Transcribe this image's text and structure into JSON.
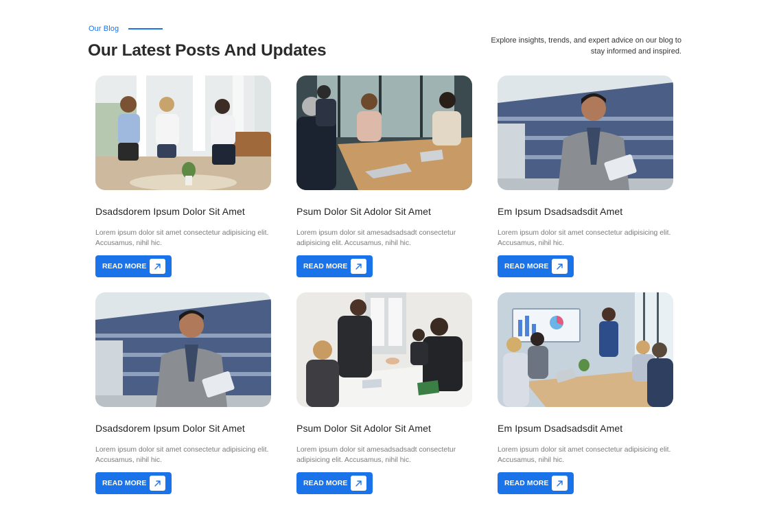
{
  "header": {
    "tag": "Our Blog",
    "title": "Our Latest Posts And Updates",
    "intro": "Explore insights, trends, and expert advice on our blog to stay informed and inspired."
  },
  "colors": {
    "accent": "#1a73e8",
    "title": "#2b2b2b",
    "excerpt": "#7a7a7a"
  },
  "posts": [
    {
      "title": "Dsadsdorem Ipsum Dolor Sit Amet",
      "excerpt": "Lorem ipsum dolor sit amet consectetur adipisicing elit. Accusamus, nihil hic.",
      "button": "READ MORE",
      "button_icon": "arrow-up-right-icon",
      "image": "office-lounge-meeting"
    },
    {
      "title": "Psum Dolor Sit Adolor Sit Amet",
      "excerpt": "Lorem ipsum dolor sit amesadsadsadt consectetur adipisicing elit. Accusamus, nihil hic.",
      "button": "READ MORE",
      "button_icon": "arrow-up-right-icon",
      "image": "conference-table-team"
    },
    {
      "title": "Em Ipsum Dsadsadsdit Amet",
      "excerpt": "Lorem ipsum dolor sit amet consectetur adipisicing elit. Accusamus, nihil hic.",
      "button": "READ MORE",
      "button_icon": "arrow-up-right-icon",
      "image": "businessman-with-tablet"
    },
    {
      "title": "Dsadsdorem Ipsum Dolor Sit Amet",
      "excerpt": "Lorem ipsum dolor sit amet consectetur adipisicing elit. Accusamus, nihil hic.",
      "button": "READ MORE",
      "button_icon": "arrow-up-right-icon",
      "image": "businessman-with-tablet"
    },
    {
      "title": "Psum Dolor Sit Adolor Sit Amet",
      "excerpt": "Lorem ipsum dolor sit amesadsadsadt consectetur adipisicing elit. Accusamus, nihil hic.",
      "button": "READ MORE",
      "button_icon": "arrow-up-right-icon",
      "image": "handshake-meeting"
    },
    {
      "title": "Em Ipsum Dsadsadsdit Amet",
      "excerpt": "Lorem ipsum dolor sit amet consectetur adipisicing elit. Accusamus, nihil hic.",
      "button": "READ MORE",
      "button_icon": "arrow-up-right-icon",
      "image": "boardroom-presentation"
    }
  ]
}
